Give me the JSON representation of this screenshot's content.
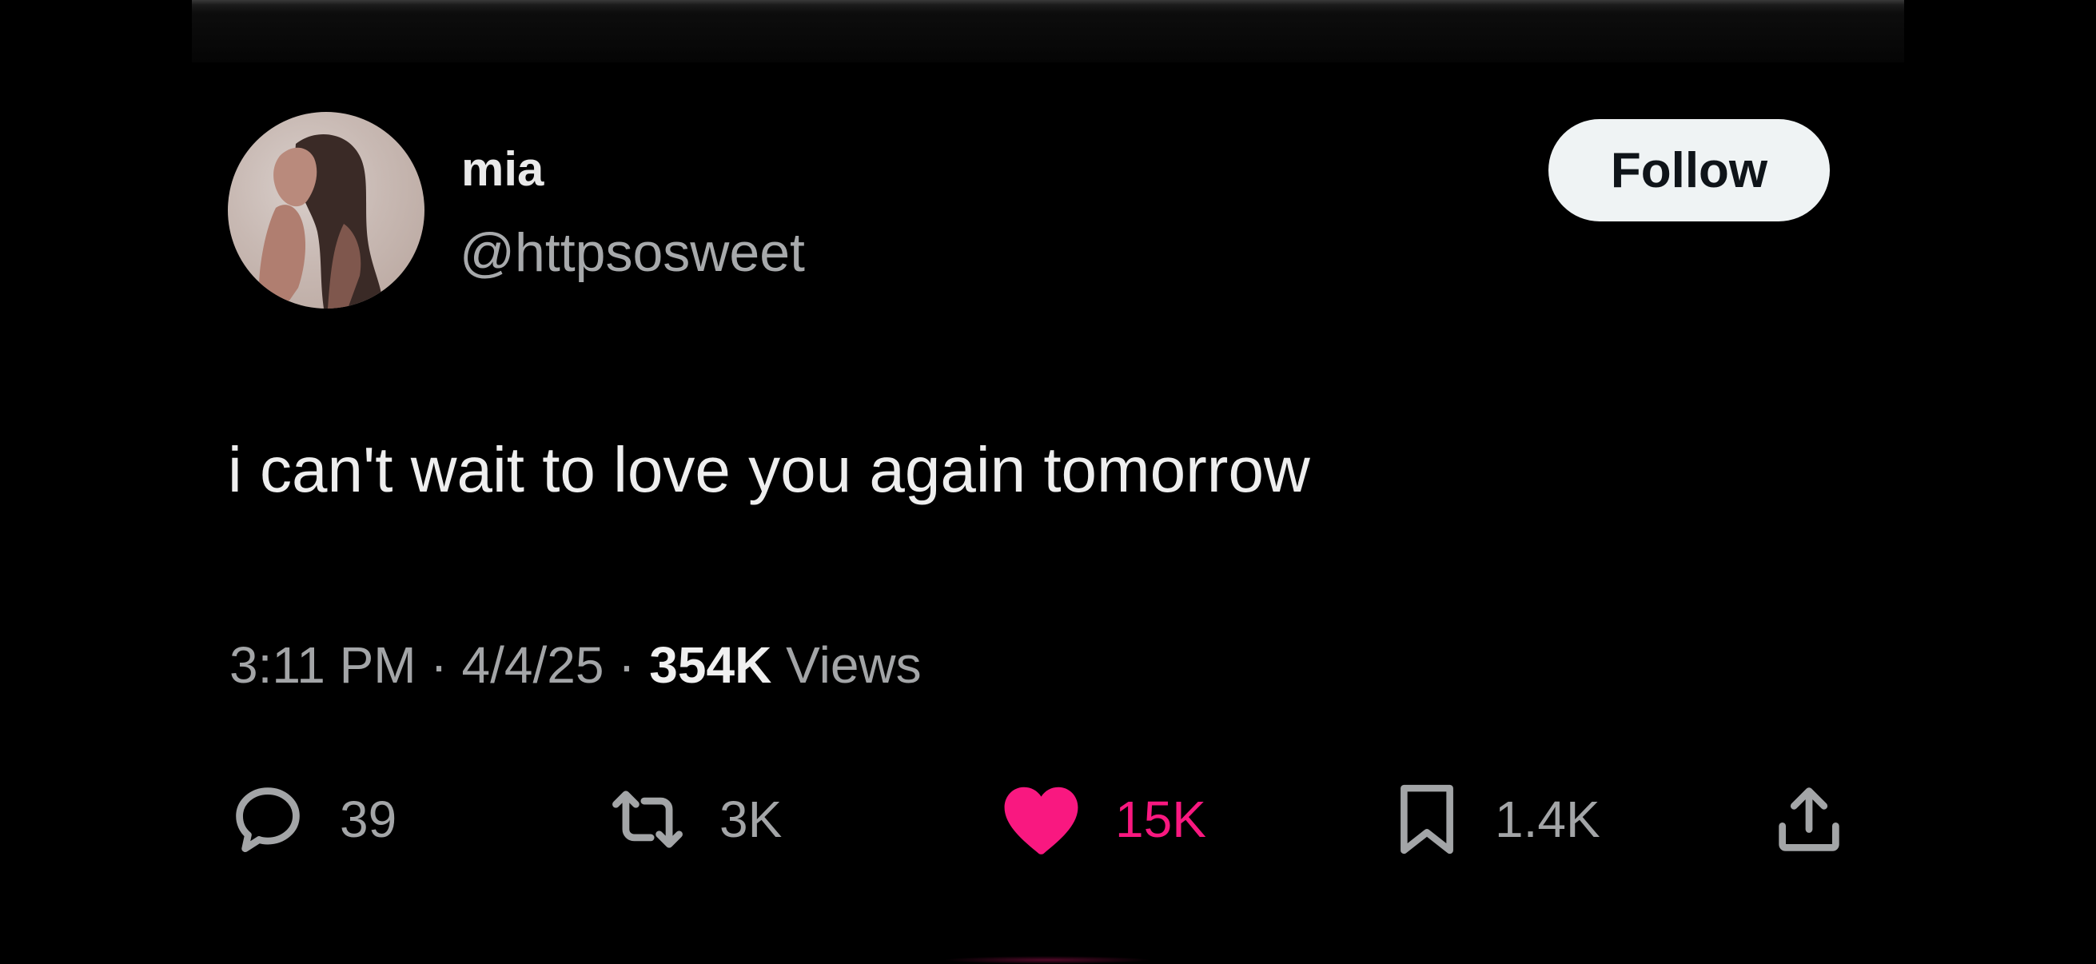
{
  "user": {
    "display_name": "mia",
    "handle": "@httpsosweet",
    "avatar_icon": "profile-photo"
  },
  "follow_button": {
    "label": "Follow"
  },
  "tweet": {
    "text": "i can't wait to love you again tomorrow",
    "time": "3:11 PM",
    "date": "4/4/25",
    "separator": "·",
    "views_count": "354K",
    "views_label": "Views"
  },
  "actions": {
    "reply": {
      "icon": "reply-icon",
      "count": "39"
    },
    "retweet": {
      "icon": "retweet-icon",
      "count": "3K"
    },
    "like": {
      "icon": "heart-icon",
      "count": "15K",
      "active": true,
      "color": "#f91880"
    },
    "bookmark": {
      "icon": "bookmark-icon",
      "count": "1.4K"
    },
    "share": {
      "icon": "share-icon"
    }
  },
  "colors": {
    "background": "#000000",
    "text_primary": "#e7e9ea",
    "text_secondary": "#a3a5a7",
    "like_accent": "#f91880",
    "button_bg": "#eff3f4"
  }
}
